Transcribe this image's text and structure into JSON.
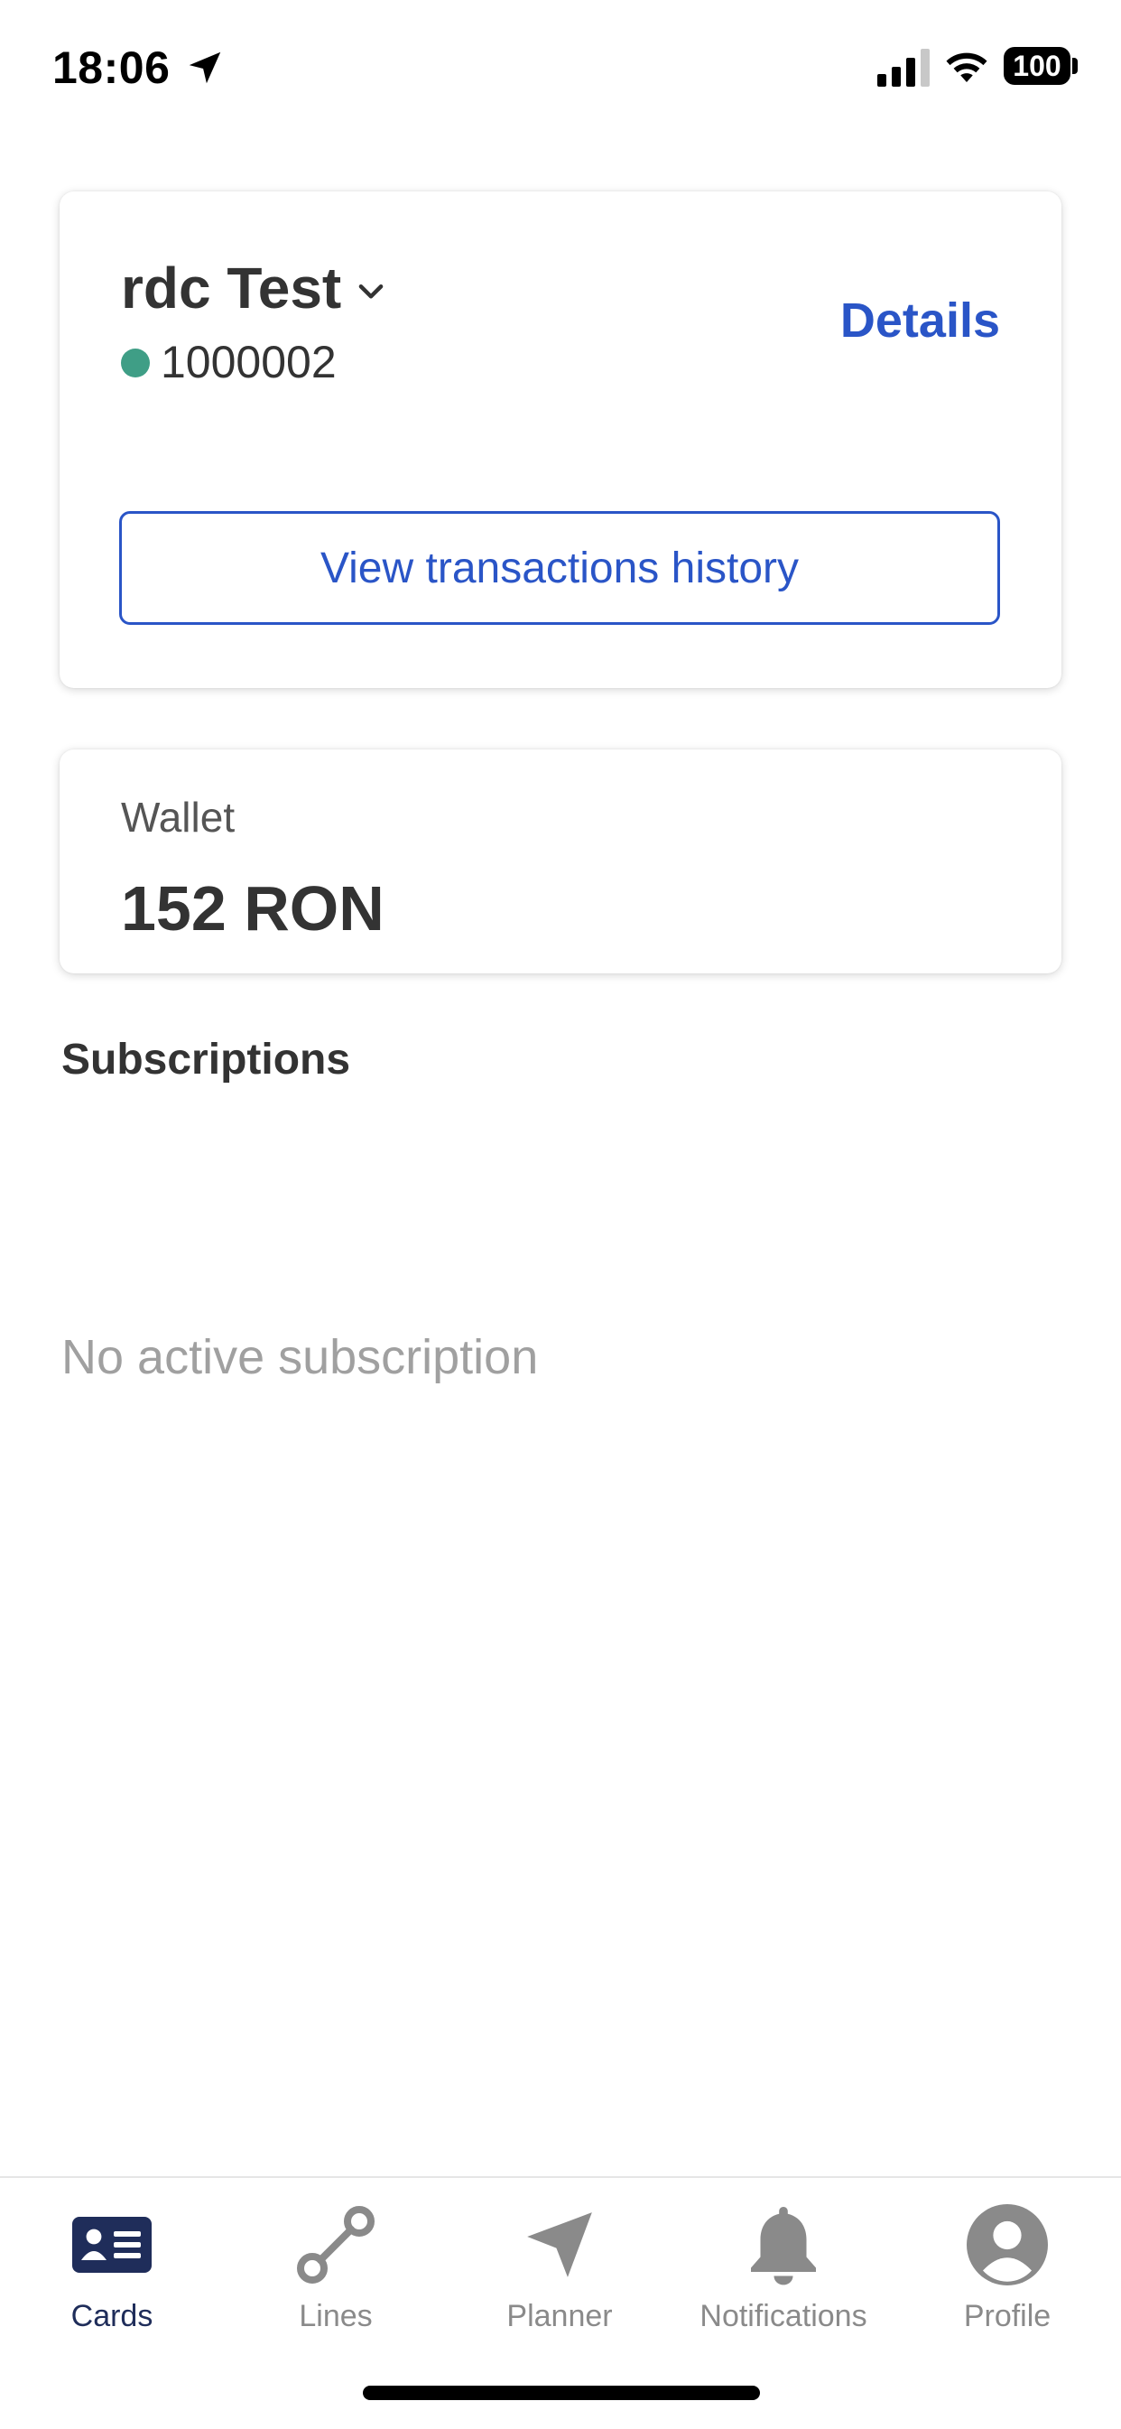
{
  "status_bar": {
    "time": "18:06",
    "battery": "100"
  },
  "card": {
    "name": "rdc Test",
    "number": "1000002",
    "details_label": "Details",
    "history_button_label": "View transactions history"
  },
  "wallet": {
    "label": "Wallet",
    "value": "152 RON"
  },
  "subscriptions": {
    "title": "Subscriptions",
    "empty_text": "No active subscription"
  },
  "tab_bar": {
    "tabs": [
      {
        "label": "Cards",
        "icon": "id-card-icon",
        "active": true
      },
      {
        "label": "Lines",
        "icon": "route-icon",
        "active": false
      },
      {
        "label": "Planner",
        "icon": "navigation-arrow-icon",
        "active": false
      },
      {
        "label": "Notifications",
        "icon": "bell-icon",
        "active": false
      },
      {
        "label": "Profile",
        "icon": "user-avatar-icon",
        "active": false
      }
    ]
  },
  "colors": {
    "accent": "#2a55c7",
    "active_tab": "#1f2d5a",
    "inactive_tab": "#8a8a8a",
    "status_dot": "#3f9e86",
    "placeholder_text": "#a0a0a0"
  }
}
